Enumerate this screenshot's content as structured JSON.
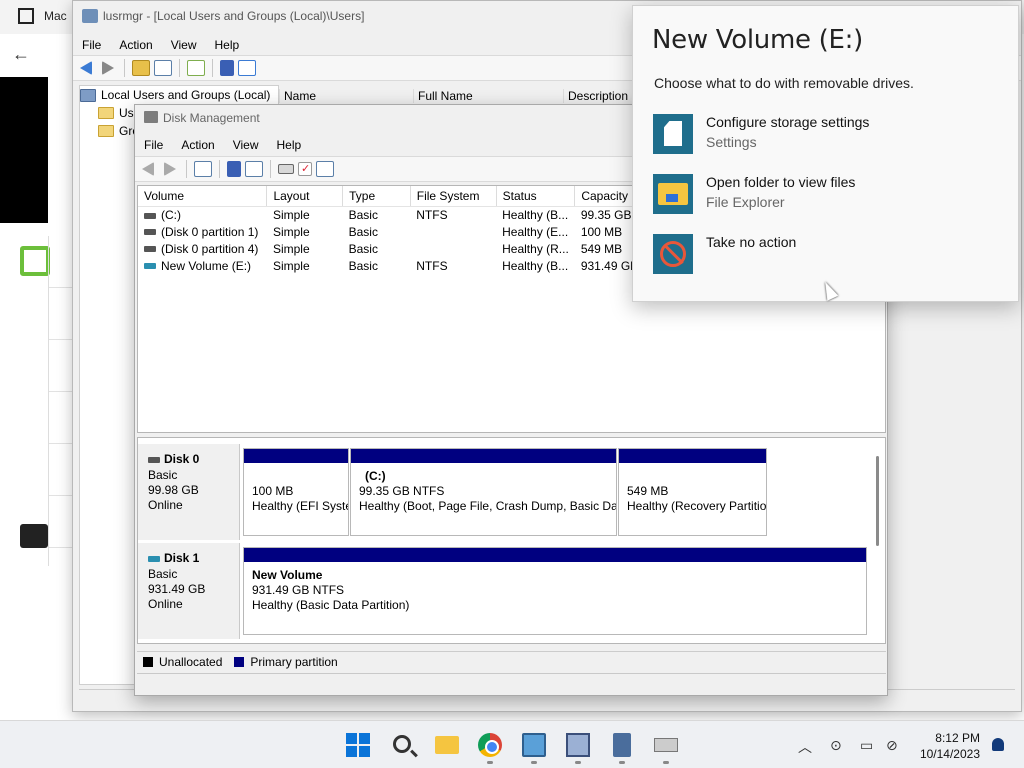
{
  "background_app": {
    "title": "Mac"
  },
  "lusrmgr": {
    "title": "lusrmgr - [Local Users and Groups (Local)\\Users]",
    "menu": [
      "File",
      "Action",
      "View",
      "Help"
    ],
    "tree": [
      {
        "label": "Local Users and Groups (Local)",
        "icon": "computer-management-icon"
      },
      {
        "label": "Us",
        "icon": "folder-icon"
      },
      {
        "label": "Gro",
        "icon": "folder-icon"
      }
    ],
    "columns": [
      "Name",
      "Full Name",
      "Description"
    ]
  },
  "disk_management": {
    "title": "Disk Management",
    "menu": [
      "File",
      "Action",
      "View",
      "Help"
    ],
    "volume_columns": [
      "Volume",
      "Layout",
      "Type",
      "File System",
      "Status",
      "Capacity"
    ],
    "volumes": [
      {
        "volume": "(C:)",
        "layout": "Simple",
        "type": "Basic",
        "fs": "NTFS",
        "status": "Healthy (B...",
        "capacity": "99.35 GB",
        "icon": "drive-icon"
      },
      {
        "volume": "(Disk 0 partition 1)",
        "layout": "Simple",
        "type": "Basic",
        "fs": "",
        "status": "Healthy (E...",
        "capacity": "100 MB",
        "icon": "drive-icon"
      },
      {
        "volume": "(Disk 0 partition 4)",
        "layout": "Simple",
        "type": "Basic",
        "fs": "",
        "status": "Healthy (R...",
        "capacity": "549 MB",
        "icon": "drive-icon"
      },
      {
        "volume": "New Volume (E:)",
        "layout": "Simple",
        "type": "Basic",
        "fs": "NTFS",
        "status": "Healthy (B...",
        "capacity": "931.49 GB",
        "icon": "usb-drive-icon"
      }
    ],
    "disks": [
      {
        "name": "Disk 0",
        "kind": "Basic",
        "size": "99.98 GB",
        "state": "Online",
        "partitions": [
          {
            "title": "",
            "line1": "100 MB",
            "line2": "Healthy (EFI System Partition)"
          },
          {
            "title": "(C:)",
            "line1": "99.35 GB NTFS",
            "line2": "Healthy (Boot, Page File, Crash Dump, Basic Data Partition)"
          },
          {
            "title": "",
            "line1": "549 MB",
            "line2": "Healthy (Recovery Partition)"
          }
        ]
      },
      {
        "name": "Disk 1",
        "kind": "Basic",
        "size": "931.49 GB",
        "state": "Online",
        "partitions": [
          {
            "title": "New Volume",
            "line1": "931.49 GB NTFS",
            "line2": "Healthy (Basic Data Partition)"
          }
        ]
      }
    ],
    "legend": [
      {
        "label": "Unallocated",
        "color": "#000000"
      },
      {
        "label": "Primary partition",
        "color": "#000080"
      }
    ]
  },
  "autoplay": {
    "title": "New Volume (E:)",
    "subtitle": "Choose what to do with removable drives.",
    "options": [
      {
        "label": "Configure storage settings",
        "sub": "Settings",
        "icon": "sd-card-icon"
      },
      {
        "label": "Open folder to view files",
        "sub": "File Explorer",
        "icon": "folder-icon"
      },
      {
        "label": "Take no action",
        "sub": "",
        "icon": "no-action-icon"
      }
    ]
  },
  "taskbar": {
    "apps": [
      "start-icon",
      "search-icon",
      "file-explorer-icon",
      "chrome-icon",
      "control-panel-icon",
      "network-app-icon",
      "calculator-icon",
      "usb-icon"
    ],
    "time": "8:12 PM",
    "date": "10/14/2023"
  }
}
